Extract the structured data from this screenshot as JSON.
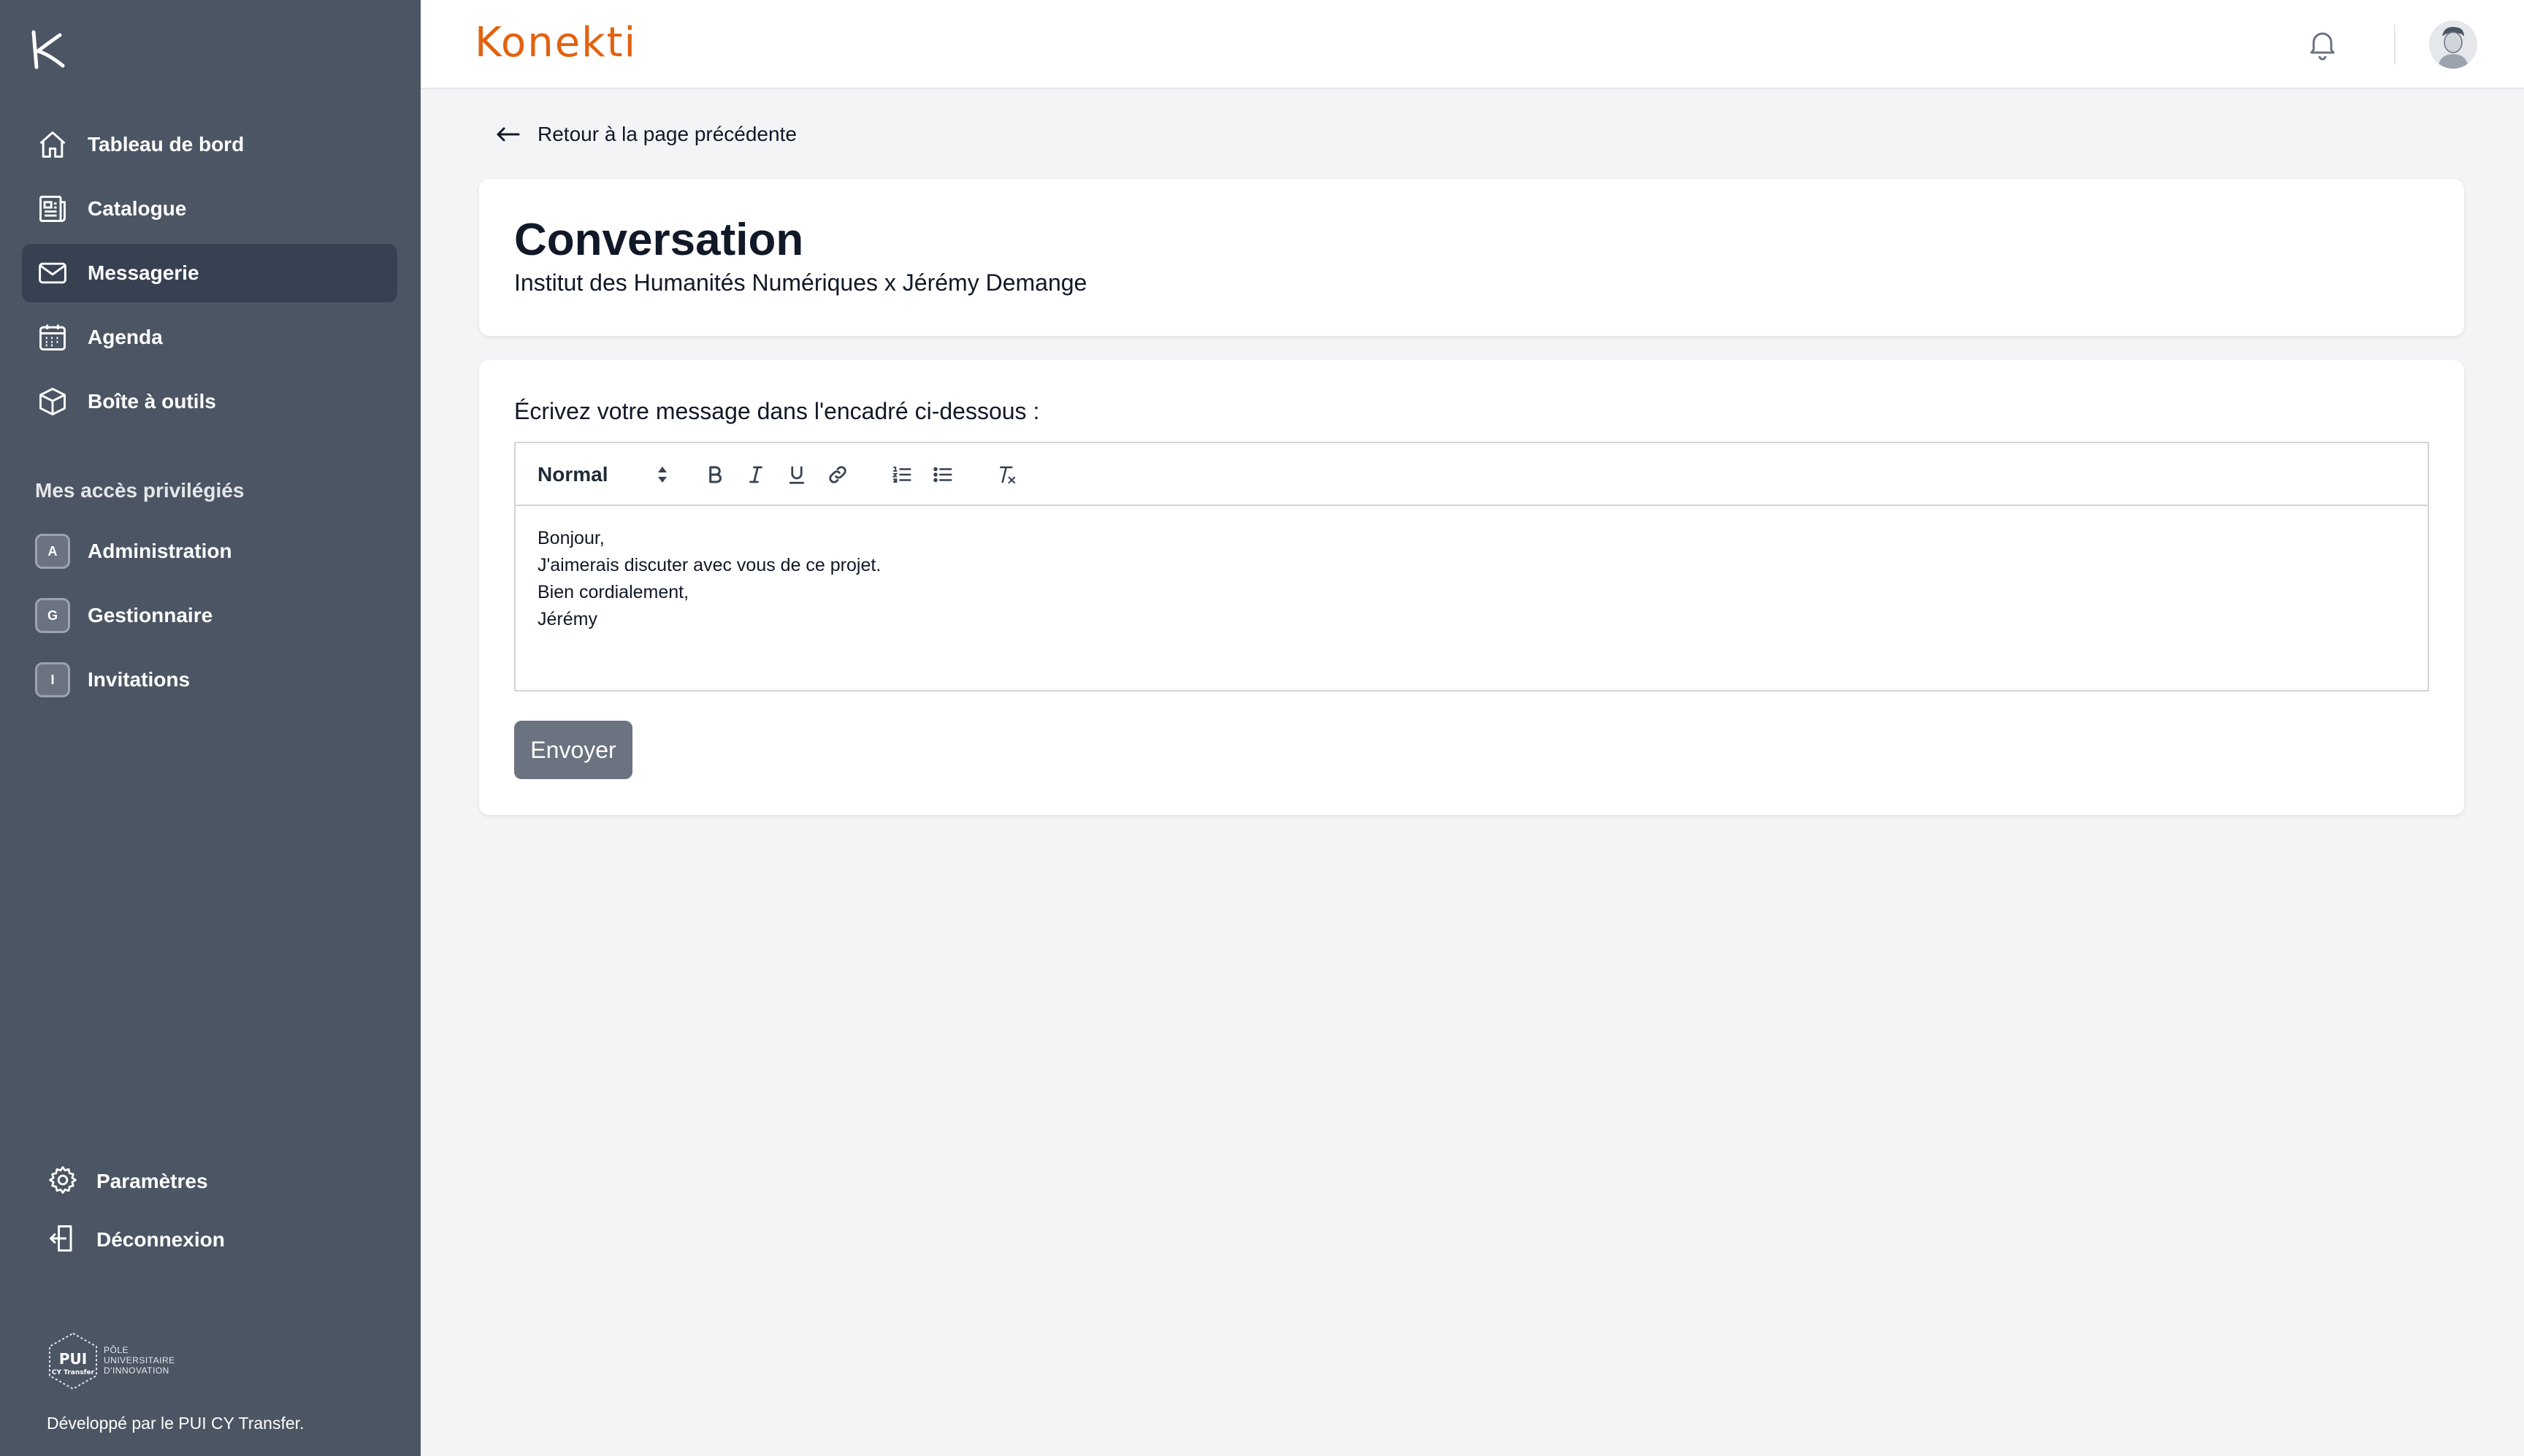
{
  "brand": {
    "name": "Konekti",
    "accent": "#e2620f"
  },
  "sidebar": {
    "bg": "#4b5563",
    "items": [
      {
        "label": "Tableau de bord",
        "icon": "home-icon"
      },
      {
        "label": "Catalogue",
        "icon": "catalog-icon"
      },
      {
        "label": "Messagerie",
        "icon": "mail-icon",
        "active": true
      },
      {
        "label": "Agenda",
        "icon": "calendar-icon"
      },
      {
        "label": "Boîte à outils",
        "icon": "cube-icon"
      }
    ],
    "section_title": "Mes accès privilégiés",
    "privileged": [
      {
        "badge": "A",
        "label": "Administration"
      },
      {
        "badge": "G",
        "label": "Gestionnaire"
      },
      {
        "badge": "I",
        "label": "Invitations"
      }
    ],
    "bottom": [
      {
        "label": "Paramètres",
        "icon": "gear-icon"
      },
      {
        "label": "Déconnexion",
        "icon": "logout-icon"
      }
    ],
    "partner_logo": {
      "abbr": "PUI",
      "sub": "CY Transfer",
      "text": "PÔLE UNIVERSITAIRE D'INNOVATION"
    },
    "footer": "Développé par le PUI CY Transfer."
  },
  "main": {
    "back_label": "Retour à la page précédente",
    "conversation": {
      "title": "Conversation",
      "subtitle": "Institut des Humanités Numériques x Jérémy Demange"
    },
    "composer": {
      "prompt": "Écrivez votre message dans l'encadré ci-dessous :",
      "format_select": "Normal",
      "message_lines": [
        "Bonjour,",
        "J'aimerais discuter avec vous de ce projet.",
        "Bien cordialement,",
        "Jérémy"
      ],
      "send_label": "Envoyer"
    }
  }
}
